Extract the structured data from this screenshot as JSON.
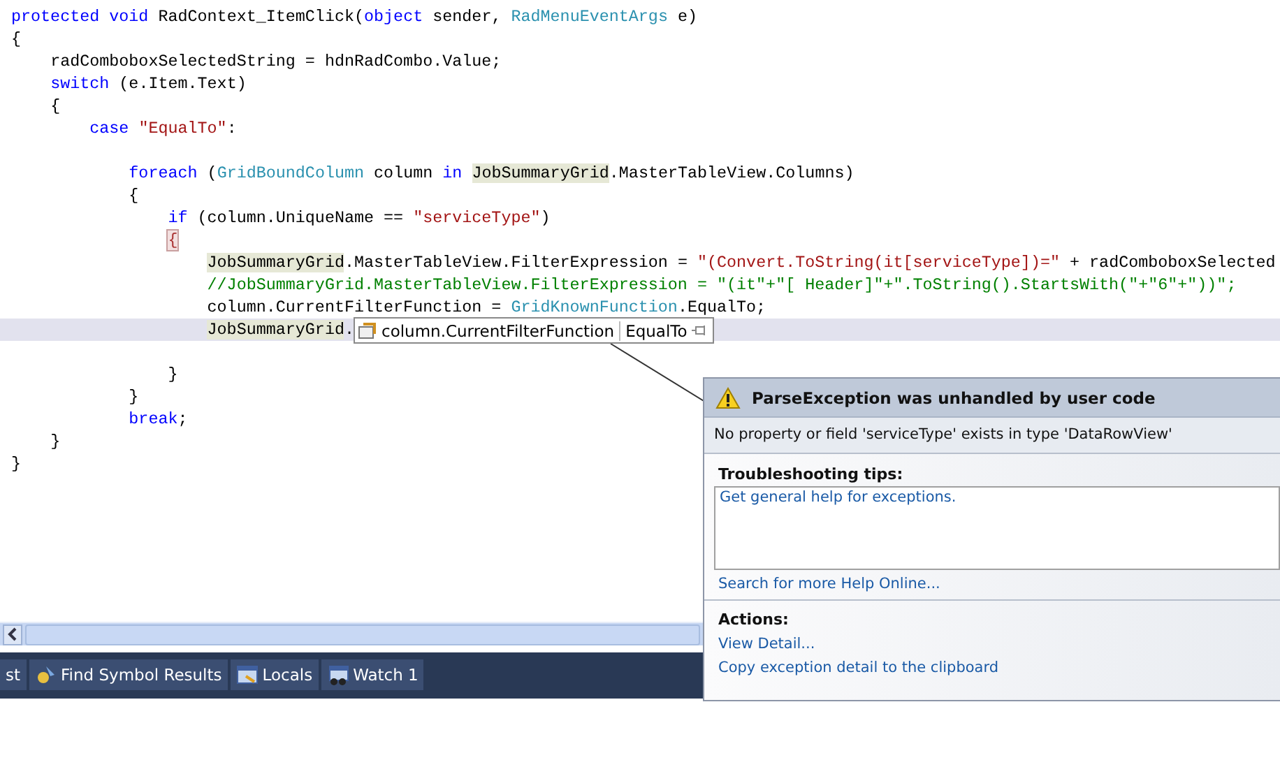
{
  "editor": {
    "lines": [
      {
        "segments": [
          {
            "t": "protected",
            "kind": "keyword"
          },
          {
            "t": " void",
            "kind": "keyword"
          },
          {
            "t": " RadContext_ItemClick(",
            "kind": "plain"
          },
          {
            "t": "object",
            "kind": "keyword"
          },
          {
            "t": " sender, ",
            "kind": "plain"
          },
          {
            "t": "RadMenuEventArgs",
            "kind": "type"
          },
          {
            "t": " e)",
            "kind": "plain"
          }
        ],
        "current": false
      },
      {
        "segments": [
          {
            "t": "{",
            "kind": "plain"
          }
        ],
        "current": false
      },
      {
        "segments": [
          {
            "t": "    radComboboxSelectedString = hdnRadCombo.Value;",
            "kind": "plain"
          }
        ],
        "current": false
      },
      {
        "segments": [
          {
            "t": "    switch",
            "kind": "keyword"
          },
          {
            "t": " (e.Item.Text)",
            "kind": "plain"
          }
        ],
        "current": false
      },
      {
        "segments": [
          {
            "t": "    {",
            "kind": "plain"
          }
        ],
        "current": false
      },
      {
        "segments": [
          {
            "t": "        case",
            "kind": "keyword"
          },
          {
            "t": " \"EqualTo\"",
            "kind": "string"
          },
          {
            "t": ":",
            "kind": "plain"
          }
        ],
        "current": false
      },
      {
        "current": false
      },
      {
        "segments": [
          {
            "t": "            foreach",
            "kind": "keyword"
          },
          {
            "t": " (",
            "kind": "plain"
          },
          {
            "t": "GridBoundColumn",
            "kind": "type"
          },
          {
            "t": " column ",
            "kind": "plain"
          },
          {
            "t": "in ",
            "kind": "keyword"
          },
          {
            "t": "JobSummaryGrid",
            "kind": "reference"
          },
          {
            "t": ".MasterTableView.Columns)",
            "kind": "plain"
          }
        ],
        "current": false
      },
      {
        "segments": [
          {
            "t": "            {",
            "kind": "plain"
          }
        ],
        "current": false
      },
      {
        "segments": [
          {
            "t": "                if",
            "kind": "keyword"
          },
          {
            "t": " (column.UniqueName == ",
            "kind": "plain"
          },
          {
            "t": "\"serviceType\"",
            "kind": "string"
          },
          {
            "t": ")",
            "kind": "plain"
          }
        ],
        "current": false
      },
      {
        "segments": [
          {
            "t": "                {",
            "kind": "brace"
          }
        ],
        "current": false
      },
      {
        "segments": [
          {
            "t": "                    JobSummaryGrid",
            "kind": "reference"
          },
          {
            "t": ".MasterTableView.FilterExpression = ",
            "kind": "plain"
          },
          {
            "t": "\"(Convert.ToString(it[serviceType])=\"",
            "kind": "string"
          },
          {
            "t": " + radComboboxSelected",
            "kind": "plain"
          }
        ],
        "current": false
      },
      {
        "segments": [
          {
            "t": "                    //JobSummaryGrid.MasterTableView.FilterExpression = \"(it\"+\"[ Header]\"+\".ToString().StartsWith(\"+\"6\"+\"))\";",
            "kind": "comment"
          }
        ],
        "current": false
      },
      {
        "segments": [
          {
            "t": "                    column.CurrentFilterFunction = ",
            "kind": "plain"
          },
          {
            "t": "GridKnownFunction",
            "kind": "type"
          },
          {
            "t": ".EqualTo;",
            "kind": "plain"
          }
        ],
        "current": false
      },
      {
        "segments": [
          {
            "t": "                    JobSummaryGrid",
            "kind": "reference"
          },
          {
            "t": ".",
            "kind": "plain"
          }
        ],
        "current": true
      },
      {
        "current": false
      },
      {
        "segments": [
          {
            "t": "                }",
            "kind": "plain"
          }
        ],
        "current": false
      },
      {
        "segments": [
          {
            "t": "            }",
            "kind": "plain"
          }
        ],
        "current": false
      },
      {
        "segments": [
          {
            "t": "            break",
            "kind": "keyword"
          },
          {
            "t": ";",
            "kind": "plain"
          }
        ],
        "current": false
      },
      {
        "segments": [
          {
            "t": "    }",
            "kind": "plain"
          }
        ],
        "current": false
      },
      {
        "segments": [
          {
            "t": "}",
            "kind": "plain"
          }
        ],
        "current": false
      }
    ]
  },
  "datatip": {
    "expression": "column.CurrentFilterFunction",
    "value": "EqualTo"
  },
  "exception": {
    "title": "ParseException was unhandled by user code",
    "message": "No property or field 'serviceType' exists in type 'DataRowView'",
    "tips_heading": "Troubleshooting tips:",
    "tips": [
      "Get general help for exceptions."
    ],
    "search_link": "Search for more Help Online...",
    "actions_heading": "Actions:",
    "actions": [
      "View Detail...",
      "Copy exception detail to the clipboard"
    ]
  },
  "tool_tabs": [
    {
      "label": "st",
      "kind": "cut"
    },
    {
      "label": "Find Symbol Results",
      "kind": "find"
    },
    {
      "label": "Locals",
      "kind": "locals"
    },
    {
      "label": "Watch 1",
      "kind": "watch"
    }
  ]
}
